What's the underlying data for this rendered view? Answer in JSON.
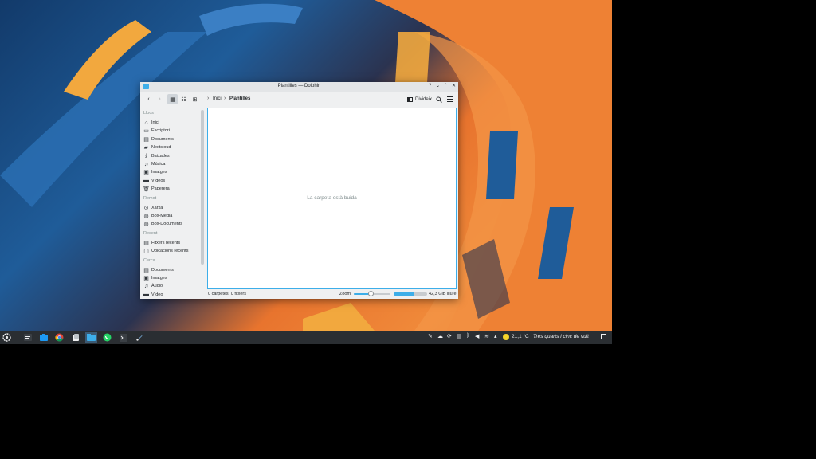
{
  "window": {
    "title": "Plantilles — Dolphin",
    "controls": {
      "help": "?",
      "minimize": "⌄",
      "maximize": "⌃",
      "close": "✕"
    }
  },
  "toolbar": {
    "back_icon": "chevron-left-icon",
    "forward_icon": "chevron-right-icon",
    "view_modes": [
      "icons-view-icon",
      "compact-view-icon",
      "details-view-icon"
    ],
    "breadcrumb": [
      "Inici",
      "Plantilles"
    ],
    "split_label": "Divideix",
    "search_icon": "search-icon",
    "menu_icon": "hamburger-menu-icon"
  },
  "sidebar": {
    "groups": [
      {
        "title": "Llocs",
        "items": [
          {
            "label": "Inici",
            "icon": "home-icon"
          },
          {
            "label": "Escriptori",
            "icon": "desktop-icon"
          },
          {
            "label": "Documents",
            "icon": "documents-icon"
          },
          {
            "label": "Nextcloud",
            "icon": "folder-icon"
          },
          {
            "label": "Baixades",
            "icon": "download-icon"
          },
          {
            "label": "Música",
            "icon": "music-icon"
          },
          {
            "label": "Imatges",
            "icon": "image-icon"
          },
          {
            "label": "Vídeos",
            "icon": "video-icon"
          },
          {
            "label": "Paperera",
            "icon": "trash-icon"
          }
        ]
      },
      {
        "title": "Remot",
        "items": [
          {
            "label": "Xarxa",
            "icon": "network-icon"
          },
          {
            "label": "Box-Media",
            "icon": "globe-icon"
          },
          {
            "label": "Box-Documents",
            "icon": "globe-icon"
          }
        ]
      },
      {
        "title": "Recent",
        "items": [
          {
            "label": "Fitxers recents",
            "icon": "recent-files-icon"
          },
          {
            "label": "Ubicacions recents",
            "icon": "recent-locations-icon"
          }
        ]
      },
      {
        "title": "Cerca",
        "items": [
          {
            "label": "Documents",
            "icon": "documents-icon"
          },
          {
            "label": "Imatges",
            "icon": "image-icon"
          },
          {
            "label": "Àudio",
            "icon": "music-icon"
          },
          {
            "label": "Vídeo",
            "icon": "video-icon"
          }
        ]
      }
    ]
  },
  "content": {
    "empty_message": "La carpeta està buida"
  },
  "statusbar": {
    "count": "0 carpetes, 0 fitxers",
    "zoom_label": "Zoom:",
    "zoom_level": 0.45,
    "free_space": "42,3 GiB lliure",
    "used_fraction": 0.62
  },
  "taskbar": {
    "apps": [
      "launcher-icon",
      "system-settings-icon",
      "store-icon",
      "chrome-icon",
      "kde-connect-icon",
      "dolphin-icon",
      "whatsapp-icon",
      "terminal-icon",
      "rocket-icon"
    ],
    "tray": [
      "notes-icon",
      "cloud-icon",
      "sync-icon",
      "clipboard-icon",
      "bluetooth-icon",
      "volume-icon",
      "wifi-icon",
      "arrow-up-icon",
      "weather-sun-icon"
    ],
    "temperature": "21,1 °C",
    "clock": "Tres quarts i cinc de vuit"
  },
  "colors": {
    "accent": "#3daee9",
    "taskbar": "#2a2e32",
    "window_bg": "#eff0f1"
  }
}
